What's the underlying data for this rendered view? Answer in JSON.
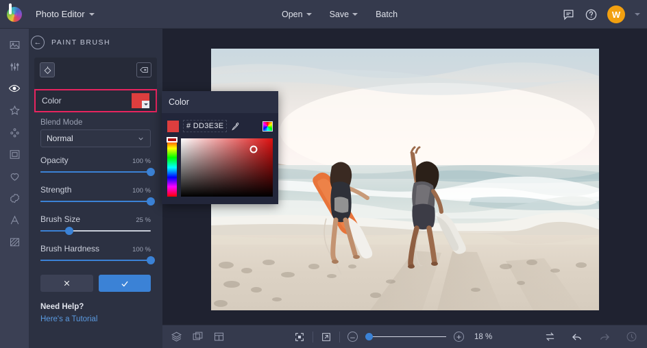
{
  "topbar": {
    "logo_icon": "color-wheel-logo",
    "app_title": "Photo Editor",
    "open_label": "Open",
    "save_label": "Save",
    "batch_label": "Batch",
    "chat_icon": "chat-bubble-icon",
    "help_icon": "question-circle-icon",
    "avatar_initial": "W"
  },
  "rail": {
    "items": [
      {
        "icon": "image-icon",
        "name": "sidebar-item-photo",
        "active": false
      },
      {
        "icon": "sliders-icon",
        "name": "sidebar-item-adjust",
        "active": false
      },
      {
        "icon": "eye-icon",
        "name": "sidebar-item-retouch",
        "active": true
      },
      {
        "icon": "star-icon",
        "name": "sidebar-item-effects",
        "active": false
      },
      {
        "icon": "overlays-icon",
        "name": "sidebar-item-overlays",
        "active": false
      },
      {
        "icon": "frame-icon",
        "name": "sidebar-item-frames",
        "active": false
      },
      {
        "icon": "heart-icon",
        "name": "sidebar-item-shapes",
        "active": false
      },
      {
        "icon": "badge-icon",
        "name": "sidebar-item-stickers",
        "active": false
      },
      {
        "icon": "text-a-icon",
        "name": "sidebar-item-text",
        "active": false
      },
      {
        "icon": "texture-icon",
        "name": "sidebar-item-texture",
        "active": false
      }
    ]
  },
  "panel": {
    "back_icon": "back-arrow-icon",
    "title": "PAINT BRUSH",
    "paint_icon": "paint-bucket-icon",
    "erase_icon": "eraser-icon",
    "color_label": "Color",
    "color_value": "#DD3E3E",
    "blend_mode_label": "Blend Mode",
    "blend_mode_value": "Normal",
    "sliders": [
      {
        "name": "Opacity",
        "value": "100 %",
        "pct": 100
      },
      {
        "name": "Strength",
        "value": "100 %",
        "pct": 100
      },
      {
        "name": "Brush Size",
        "value": "25 %",
        "pct": 25
      },
      {
        "name": "Brush Hardness",
        "value": "100 %",
        "pct": 100
      }
    ],
    "cancel_icon": "close-x-icon",
    "apply_icon": "checkmark-icon",
    "help_title": "Need Help?",
    "help_link": "Here's a Tutorial",
    "highlight_color": "#E8245F"
  },
  "picker": {
    "title": "Color",
    "hex": "# DD3E3E",
    "swatch_color": "#DD3E3E",
    "eyedropper_icon": "eyedropper-icon",
    "wheel_icon": "color-wheel-icon"
  },
  "bottombar": {
    "layers_icon": "layers-icon",
    "transform_icon": "transform-icon",
    "panels_icon": "panel-layout-icon",
    "fit_icon": "fit-to-screen-icon",
    "fullscreen_icon": "expand-fullscreen-icon",
    "zoom_out_icon": "minus-icon",
    "zoom_in_icon": "plus-icon",
    "zoom_value": "18 %",
    "zoom_pct": 7,
    "compare_icon": "compare-swap-icon",
    "undo_icon": "undo-arrow-icon",
    "redo_icon": "redo-arrow-icon",
    "history_icon": "history-clock-icon"
  },
  "canvas": {
    "image_alt": "two-surfers-walking-on-beach"
  }
}
